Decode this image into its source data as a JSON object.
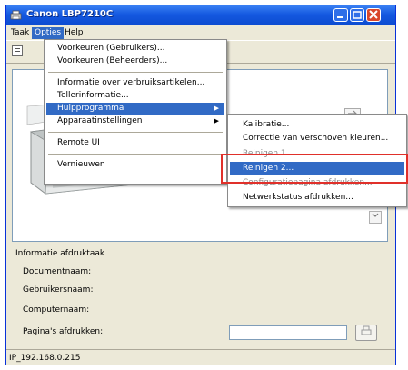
{
  "window": {
    "title": "Canon LBP7210C"
  },
  "menubar": {
    "items": [
      {
        "label": "Taak"
      },
      {
        "label": "Opties"
      },
      {
        "label": "Help"
      }
    ]
  },
  "options_menu": {
    "items": [
      {
        "label": "Voorkeuren (Gebruikers)..."
      },
      {
        "label": "Voorkeuren (Beheerders)..."
      },
      {
        "label": "Informatie over verbruiksartikelen..."
      },
      {
        "label": "Tellerinformatie..."
      },
      {
        "label": "Hulpprogramma"
      },
      {
        "label": "Apparaatinstellingen"
      },
      {
        "label": "Remote UI"
      },
      {
        "label": "Vernieuwen"
      }
    ]
  },
  "utility_submenu": {
    "items": [
      {
        "label": "Kalibratie..."
      },
      {
        "label": "Correctie van verschoven kleuren..."
      },
      {
        "label": "Reinigen 1..."
      },
      {
        "label": "Reinigen 2..."
      },
      {
        "label": "Configuratiepagina afdrukken..."
      },
      {
        "label": "Netwerkstatus afdrukken..."
      }
    ]
  },
  "job_info": {
    "header": "Informatie afdruktaak",
    "document_name": "Documentnaam:",
    "user_name": "Gebruikersnaam:",
    "computer_name": "Computernaam:",
    "pages_printed": "Pagina's afdrukken:"
  },
  "status_bar": {
    "text": "IP_192.168.0.215"
  },
  "colors": {
    "highlight": "#316ac5",
    "title_bar": "#1458e0",
    "callout": "#e0302a"
  }
}
